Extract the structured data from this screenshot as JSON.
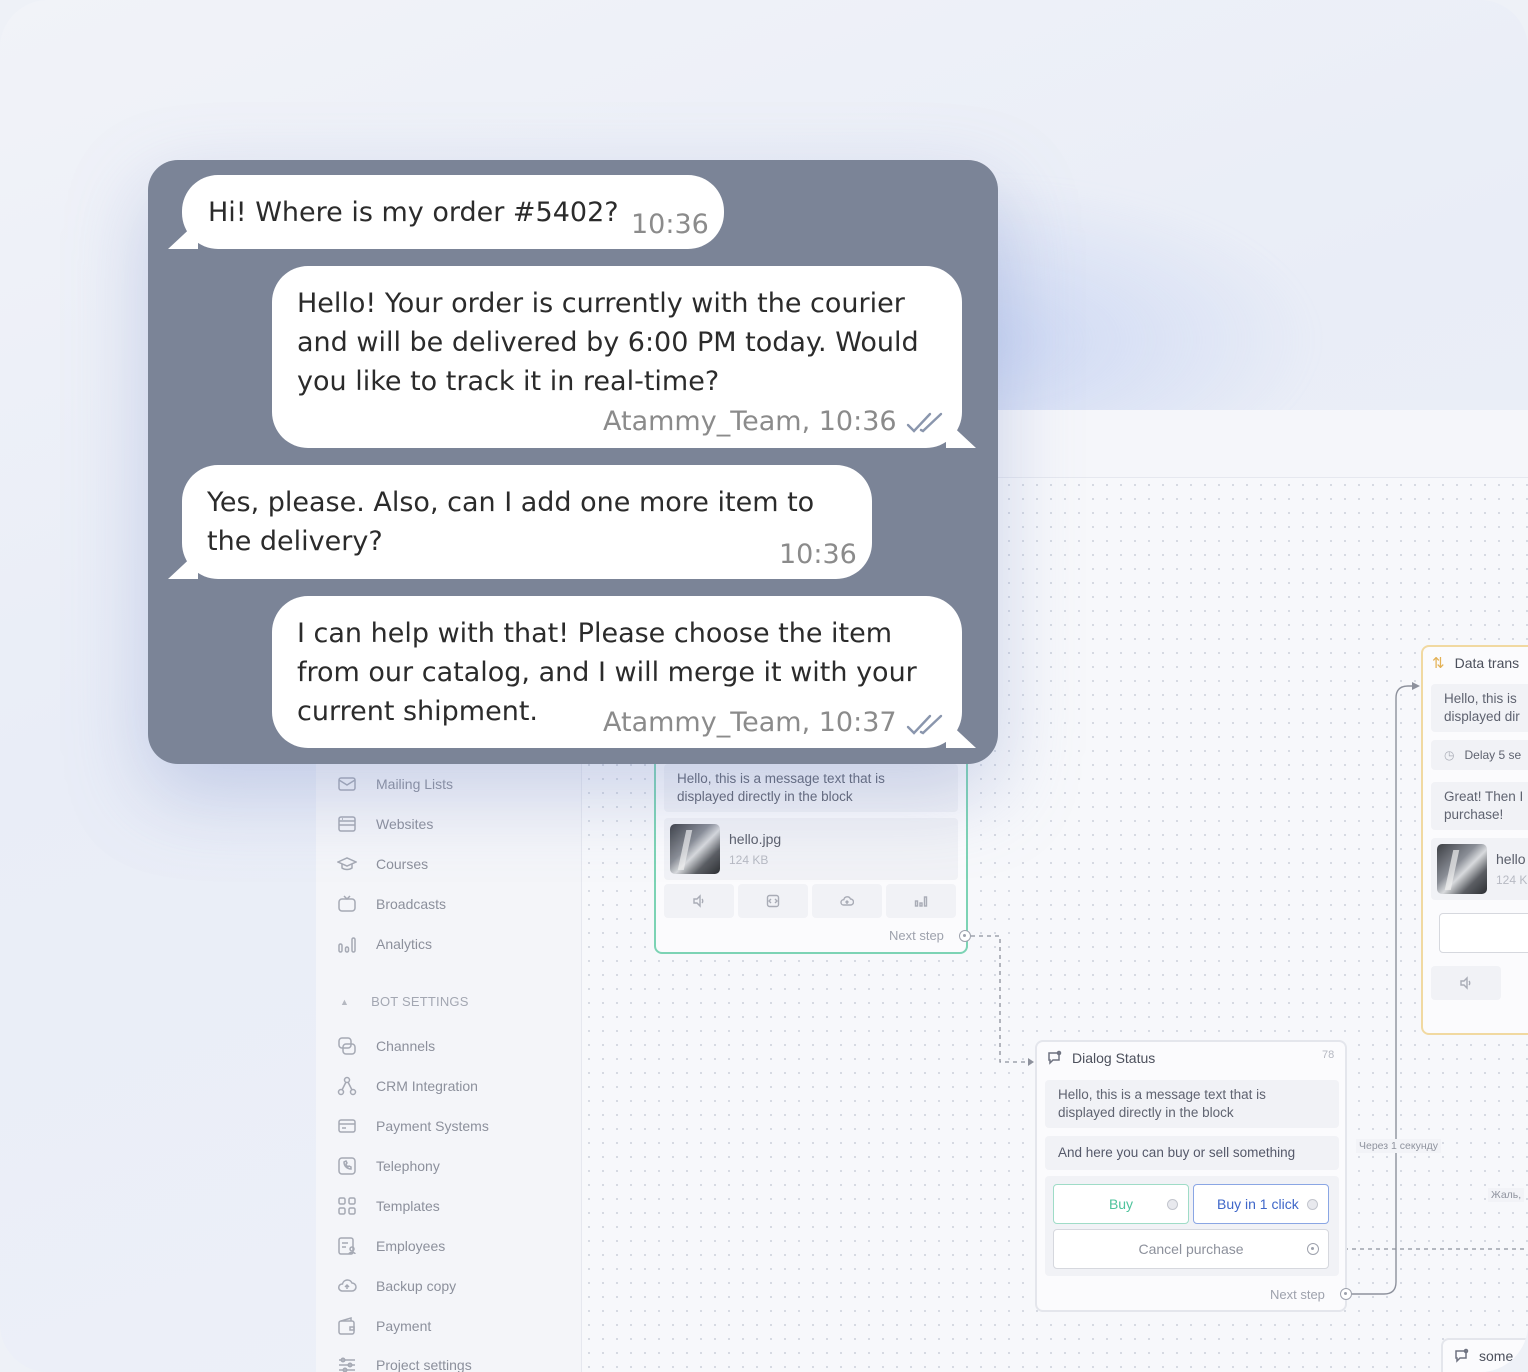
{
  "chat": {
    "messages": [
      {
        "text": "Hi! Where is my order #5402?",
        "meta": "10:36",
        "side": "in"
      },
      {
        "lines": [
          "Hello! Your order is currently with the courier",
          "and will be delivered by 6:00 PM today. Would",
          "you like to track it in real-time?"
        ],
        "meta": "Atammy_Team, 10:36",
        "side": "out",
        "read": true
      },
      {
        "lines": [
          "Yes, please. Also, can I add one more item to",
          "the delivery?"
        ],
        "meta": "10:36",
        "side": "in"
      },
      {
        "lines": [
          "I can help with that! Please choose the item",
          "from our catalog, and I will merge it with your",
          "current shipment."
        ],
        "meta": "Atammy_Team, 10:37",
        "side": "out",
        "read": true
      }
    ]
  },
  "sidebar": {
    "items": [
      {
        "label": "Mailing Lists",
        "icon": "mail-icon"
      },
      {
        "label": "Websites",
        "icon": "website-icon"
      },
      {
        "label": "Courses",
        "icon": "graduation-cap-icon"
      },
      {
        "label": "Broadcasts",
        "icon": "broadcast-icon"
      },
      {
        "label": "Analytics",
        "icon": "bar-chart-icon"
      }
    ],
    "section_title": "BOT SETTINGS",
    "settings": [
      {
        "label": "Channels",
        "icon": "channels-icon"
      },
      {
        "label": "CRM Integration",
        "icon": "crm-icon"
      },
      {
        "label": "Payment Systems",
        "icon": "credit-card-icon"
      },
      {
        "label": "Telephony",
        "icon": "phone-icon"
      },
      {
        "label": "Templates",
        "icon": "templates-icon"
      },
      {
        "label": "Employees",
        "icon": "employees-icon"
      },
      {
        "label": "Backup copy",
        "icon": "cloud-icon"
      },
      {
        "label": "Payment",
        "icon": "wallet-icon"
      },
      {
        "label": "Project settings",
        "icon": "sliders-icon"
      }
    ]
  },
  "flow": {
    "green_block": {
      "message": [
        "Hello, this is a message text that is",
        "displayed directly in the block"
      ],
      "file_name": "hello.jpg",
      "file_size": "124 KB",
      "next_step": "Next step"
    },
    "status_block": {
      "title": "Dialog Status",
      "id": "78",
      "message": [
        "Hello, this is a message text that is",
        "displayed directly in the block"
      ],
      "message2": "And here you can buy or sell something",
      "buy": "Buy",
      "buy_one_click": "Buy in 1 click",
      "cancel": "Cancel purchase",
      "next_step": "Next step"
    },
    "data_block": {
      "title": "Data trans",
      "message": [
        "Hello, this is",
        "displayed dir"
      ],
      "delay": "Delay 5 se",
      "message2": [
        "Great! Then I",
        "purchase!"
      ],
      "file_name": "hello",
      "file_size": "124 K"
    },
    "some_block": {
      "title": "some"
    },
    "edge_label_1": "Через 1 секунду",
    "edge_label_2": "Жаль,"
  },
  "colors": {
    "chat_bg": "#7b8497",
    "green_border": "#7cd3b4",
    "blue_button": "#3f67c9",
    "orange_border": "#f1d9a1"
  }
}
